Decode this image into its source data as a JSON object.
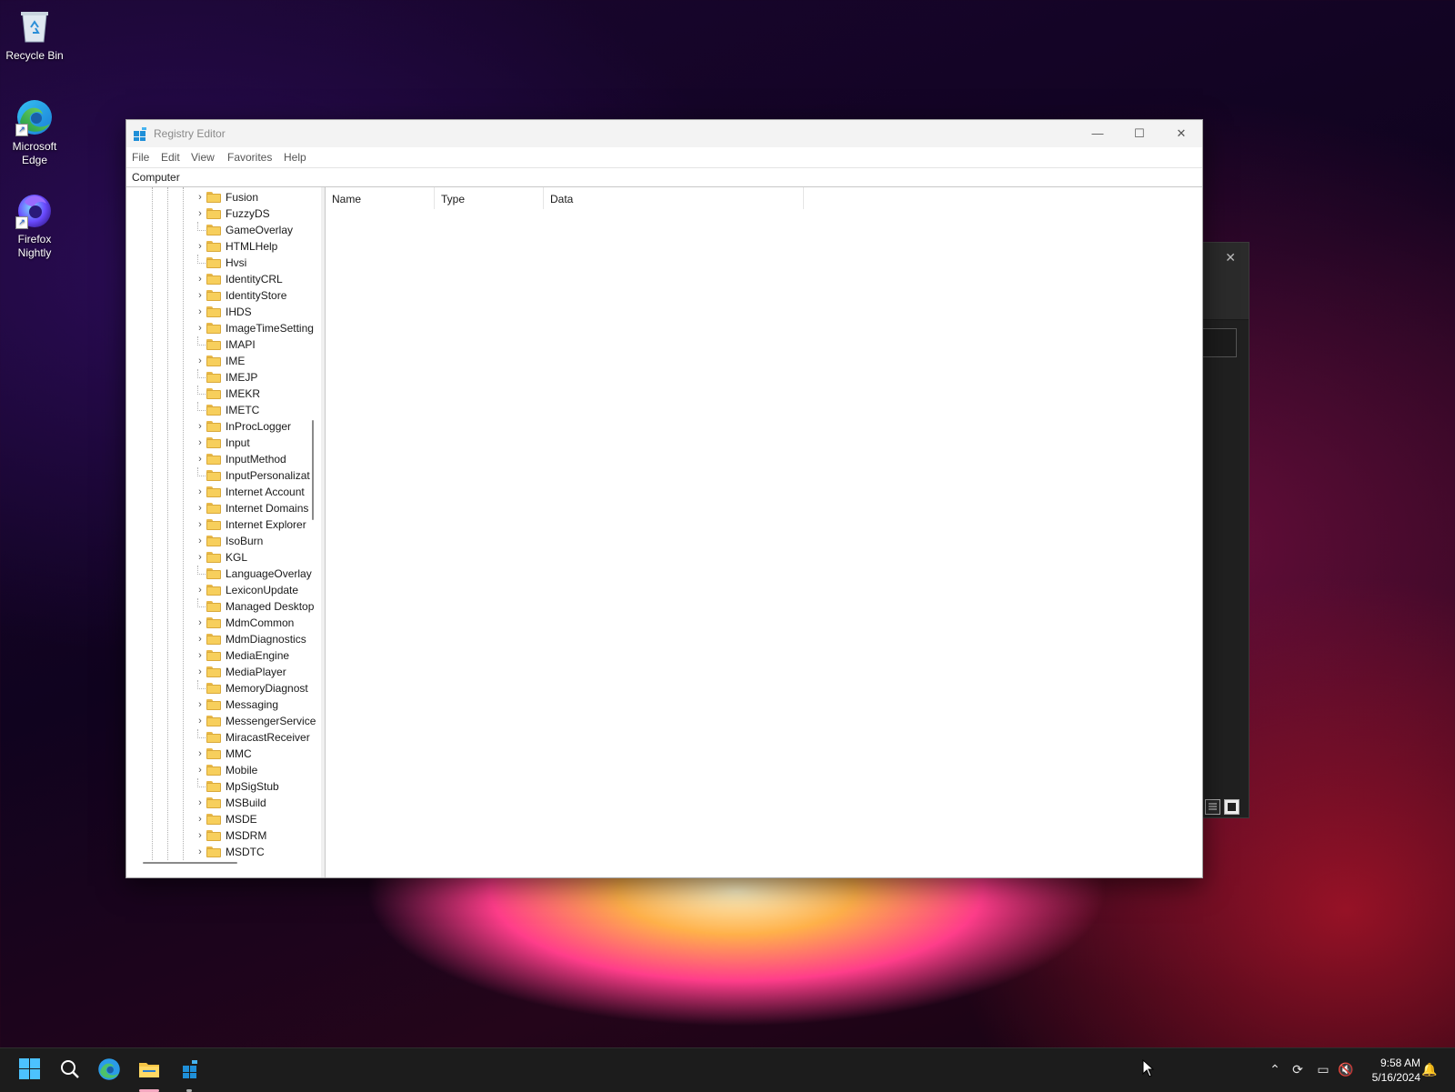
{
  "desktop": {
    "icons": [
      {
        "label": "Recycle Bin",
        "icon": "recycle-bin-icon"
      },
      {
        "label": "Microsoft Edge",
        "icon": "edge-icon"
      },
      {
        "label": "Firefox Nightly",
        "icon": "firefox-nightly-icon"
      }
    ]
  },
  "window": {
    "title": "Registry Editor",
    "controls": {
      "minimize": "—",
      "maximize": "☐",
      "close": "✕"
    },
    "menu": [
      "File",
      "Edit",
      "View",
      "Favorites",
      "Help"
    ],
    "address": "Computer",
    "tree": [
      {
        "label": "Fusion",
        "expandable": true
      },
      {
        "label": "FuzzyDS",
        "expandable": true
      },
      {
        "label": "GameOverlay",
        "expandable": false
      },
      {
        "label": "HTMLHelp",
        "expandable": true
      },
      {
        "label": "Hvsi",
        "expandable": false
      },
      {
        "label": "IdentityCRL",
        "expandable": true
      },
      {
        "label": "IdentityStore",
        "expandable": true
      },
      {
        "label": "IHDS",
        "expandable": true
      },
      {
        "label": "ImageTimeSetting",
        "expandable": true
      },
      {
        "label": "IMAPI",
        "expandable": false
      },
      {
        "label": "IME",
        "expandable": true
      },
      {
        "label": "IMEJP",
        "expandable": false
      },
      {
        "label": "IMEKR",
        "expandable": false
      },
      {
        "label": "IMETC",
        "expandable": false
      },
      {
        "label": "InProcLogger",
        "expandable": true
      },
      {
        "label": "Input",
        "expandable": true
      },
      {
        "label": "InputMethod",
        "expandable": true
      },
      {
        "label": "InputPersonalizat",
        "expandable": false
      },
      {
        "label": "Internet Account",
        "expandable": true
      },
      {
        "label": "Internet Domains",
        "expandable": true
      },
      {
        "label": "Internet Explorer",
        "expandable": true
      },
      {
        "label": "IsoBurn",
        "expandable": true
      },
      {
        "label": "KGL",
        "expandable": true
      },
      {
        "label": "LanguageOverlay",
        "expandable": false
      },
      {
        "label": "LexiconUpdate",
        "expandable": true
      },
      {
        "label": "Managed Desktop",
        "expandable": false
      },
      {
        "label": "MdmCommon",
        "expandable": true
      },
      {
        "label": "MdmDiagnostics",
        "expandable": true
      },
      {
        "label": "MediaEngine",
        "expandable": true
      },
      {
        "label": "MediaPlayer",
        "expandable": true
      },
      {
        "label": "MemoryDiagnost",
        "expandable": false
      },
      {
        "label": "Messaging",
        "expandable": true
      },
      {
        "label": "MessengerService",
        "expandable": true
      },
      {
        "label": "MiracastReceiver",
        "expandable": false
      },
      {
        "label": "MMC",
        "expandable": true
      },
      {
        "label": "Mobile",
        "expandable": true
      },
      {
        "label": "MpSigStub",
        "expandable": false
      },
      {
        "label": "MSBuild",
        "expandable": true
      },
      {
        "label": "MSDE",
        "expandable": true
      },
      {
        "label": "MSDRM",
        "expandable": true
      },
      {
        "label": "MSDTC",
        "expandable": true
      }
    ],
    "columns": [
      "Name",
      "Type",
      "Data"
    ]
  },
  "taskbar": {
    "apps": [
      "start-button",
      "search-button",
      "edge-taskbar-icon",
      "file-explorer-taskbar-icon",
      "registry-editor-taskbar-icon"
    ],
    "time": "9:58 AM",
    "date": "5/16/2024"
  },
  "colors": {
    "accent": "#4cc2ff",
    "folder": "#f7cf5c",
    "taskbar": "#1c1c1c"
  }
}
